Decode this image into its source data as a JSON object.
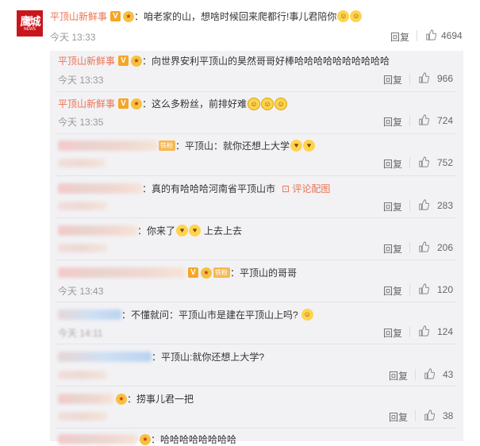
{
  "main_comment": {
    "username": "平顶山新鲜事",
    "avatar_text": "鹰城",
    "avatar_sub": "NEWS",
    "text": "：咱老家的山，想啥时候回来爬都行!事儿君陪你",
    "time": "今天 13:33",
    "reply_label": "回复",
    "likes": "4694"
  },
  "replies": [
    {
      "username": "平顶山新鲜事",
      "text": "：向世界安利平顶山的昊然哥哥好棒哈哈哈哈哈哈哈哈哈哈",
      "time": "今天 13:33",
      "reply_label": "回复",
      "likes": "966"
    },
    {
      "username": "平顶山新鲜事",
      "text": "：这么多粉丝，前排好难",
      "time": "今天 13:35",
      "reply_label": "回复",
      "likes": "724"
    },
    {
      "badge": "铁粉",
      "text": "：平顶山：就你还想上大学",
      "reply_label": "回复",
      "likes": "752"
    },
    {
      "text": "：真的有哈哈哈河南省平顶山市",
      "pic_link": "评论配图",
      "reply_label": "回复",
      "likes": "283"
    },
    {
      "text": "：你来了",
      "text2": "上去上去",
      "reply_label": "回复",
      "likes": "206"
    },
    {
      "badge": "铁粉",
      "text": "：平顶山的哥哥",
      "time": "今天 13:43",
      "reply_label": "回复",
      "likes": "120"
    },
    {
      "text": "：不懂就问：平顶山市是建在平顶山上吗?",
      "time": "今天 14:11",
      "reply_label": "回复",
      "likes": "124"
    },
    {
      "text": "：平顶山:就你还想上大学?",
      "reply_label": "回复",
      "likes": "43"
    },
    {
      "text": "：捞事儿君一把",
      "reply_label": "回复",
      "likes": "38"
    },
    {
      "text": "：哈哈哈哈哈哈哈哈"
    }
  ],
  "colors": {
    "username": "#eb7350",
    "badge_v": "#f5a623",
    "sub_bg": "#f2f2f5"
  }
}
